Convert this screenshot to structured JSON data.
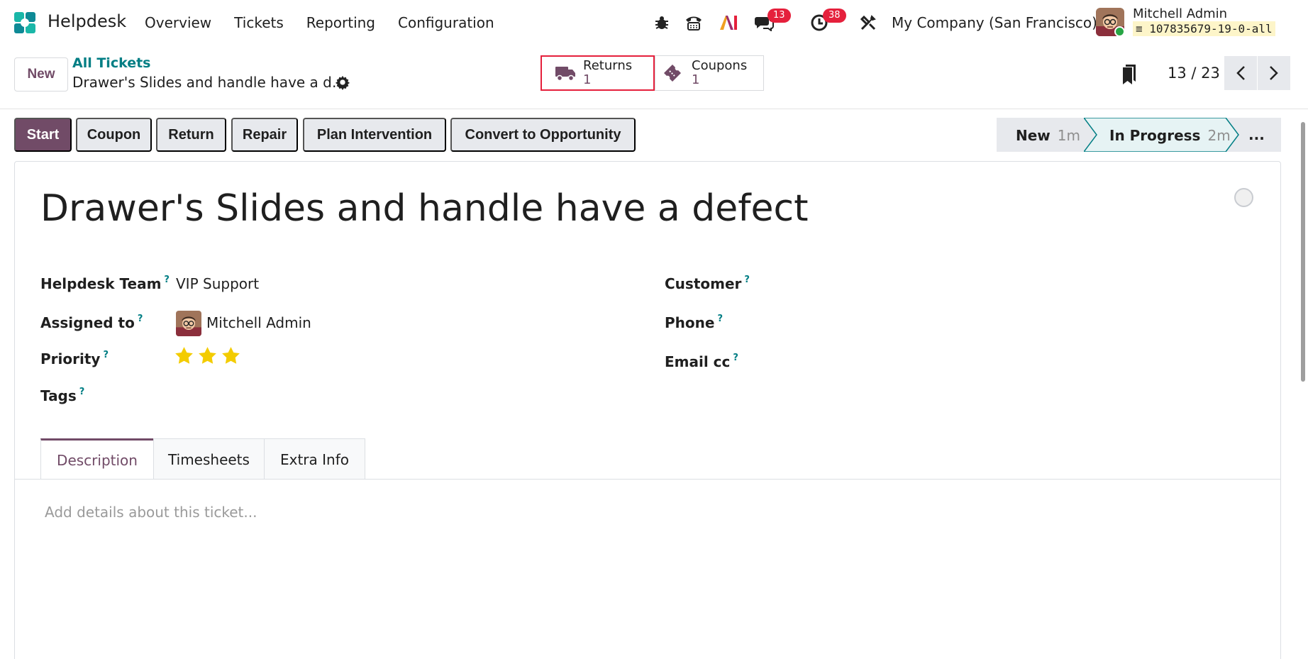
{
  "app": {
    "name": "Helpdesk"
  },
  "menu": {
    "items": [
      "Overview",
      "Tickets",
      "Reporting",
      "Configuration"
    ]
  },
  "systray": {
    "messages_count": "13",
    "activities_count": "38",
    "company": "My Company (San Francisco)",
    "user_name": "Mitchell Admin",
    "database": "107835679-19-0-all"
  },
  "control": {
    "new_label": "New",
    "breadcrumb_parent": "All Tickets",
    "breadcrumb_current": "Drawer's Slides and handle have a d…",
    "pager": "13 / 23"
  },
  "smart_buttons": [
    {
      "label": "Returns",
      "value": "1"
    },
    {
      "label": "Coupons",
      "value": "1"
    }
  ],
  "actions": [
    "Start",
    "Coupon",
    "Return",
    "Repair",
    "Plan Intervention",
    "Convert to Opportunity"
  ],
  "stages": {
    "new": {
      "label": "New",
      "time": "1m"
    },
    "current": {
      "label": "In Progress",
      "time": "2m"
    },
    "more": "..."
  },
  "ticket": {
    "title": "Drawer's Slides and handle have a defect",
    "priority_stars": 3,
    "fields_left": [
      {
        "label": "Helpdesk Team",
        "value": "VIP Support"
      },
      {
        "label": "Assigned to",
        "value": "Mitchell Admin"
      },
      {
        "label": "Priority",
        "value": ""
      },
      {
        "label": "Tags",
        "value": ""
      }
    ],
    "fields_right": [
      {
        "label": "Customer",
        "value": ""
      },
      {
        "label": "Phone",
        "value": ""
      },
      {
        "label": "Email cc",
        "value": ""
      }
    ],
    "help_mark": "?"
  },
  "tabs": [
    "Description",
    "Timesheets",
    "Extra Info"
  ],
  "description_placeholder": "Add details about this ticket...",
  "colors": {
    "brand": "#714b67",
    "link": "#017e84",
    "badge": "#e5203c"
  }
}
